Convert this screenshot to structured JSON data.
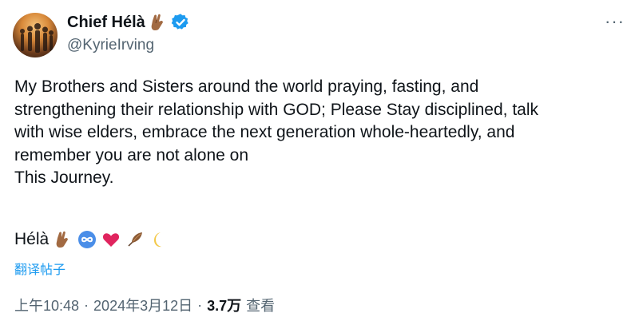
{
  "author": {
    "display_name": "Chief Hélà",
    "handle": "@KyrieIrving",
    "verified": true,
    "verified_color": "#1d9bf0"
  },
  "tweet": {
    "text": "My Brothers and Sisters around the world praying, fasting, and\nstrengthening their relationship with GOD; Please Stay disciplined, talk\nwith wise elders, embrace the next generation whole-heartedly, and\nremember you are not alone on\nThis Journey.",
    "signature": "Hélà",
    "signature_emojis": [
      "crossed-fingers-icon",
      "infinity-icon",
      "heart-icon",
      "feather-icon",
      "moon-icon"
    ]
  },
  "translate_label": "翻译帖子",
  "meta": {
    "time": "上午10:48",
    "separator": "·",
    "date": "2024年3月12日",
    "views_count": "3.7万",
    "views_label": "查看"
  },
  "more_label": "···",
  "colors": {
    "text": "#0f1419",
    "secondary": "#536471",
    "link": "#1d9bf0",
    "heart": "#e0245e"
  }
}
